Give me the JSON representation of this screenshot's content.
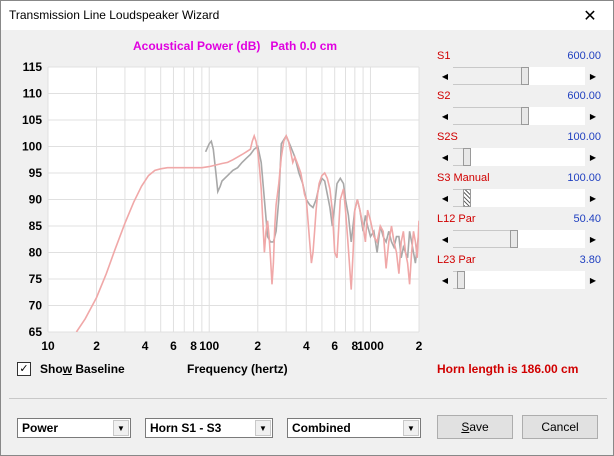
{
  "window": {
    "title": "Transmission Line Loudspeaker Wizard",
    "close_glyph": "✕"
  },
  "chart_header": "Acoustical Power (dB)   Path 0.0 cm",
  "chart_data": {
    "type": "line",
    "title": "Acoustical Power (dB)   Path 0.0 cm",
    "xlabel": "Frequency (hertz)",
    "ylabel": "",
    "x_scale": "log",
    "xlim": [
      10,
      2000
    ],
    "ylim": [
      65,
      115
    ],
    "y_ticks": [
      65,
      70,
      75,
      80,
      85,
      90,
      95,
      100,
      105,
      110,
      115
    ],
    "x_tick_labels": [
      {
        "value": 10,
        "label": "10"
      },
      {
        "value": 20,
        "label": "2"
      },
      {
        "value": 40,
        "label": "4"
      },
      {
        "value": 60,
        "label": "6"
      },
      {
        "value": 80,
        "label": "8"
      },
      {
        "value": 100,
        "label": "100"
      },
      {
        "value": 200,
        "label": "2"
      },
      {
        "value": 400,
        "label": "4"
      },
      {
        "value": 600,
        "label": "6"
      },
      {
        "value": 800,
        "label": "8"
      },
      {
        "value": 1000,
        "label": "1000"
      },
      {
        "value": 2000,
        "label": "2"
      }
    ],
    "grid": true,
    "series": [
      {
        "color": "#a8a8a8",
        "x": [
          95,
          100,
          103,
          106,
          110,
          113,
          117,
          120,
          130,
          140,
          150,
          160,
          170,
          180,
          190,
          200,
          210,
          220,
          230,
          240,
          250,
          260,
          270,
          280,
          300,
          320,
          340,
          360,
          380,
          400,
          420,
          440,
          460,
          480,
          500,
          520,
          540,
          560,
          580,
          600,
          620,
          650,
          680,
          700,
          730,
          760,
          800,
          830,
          860,
          900,
          930,
          960,
          1000,
          1050,
          1100,
          1150,
          1200,
          1250,
          1300,
          1350,
          1400,
          1450,
          1500,
          1550,
          1600,
          1650,
          1700,
          1750,
          1800,
          1850,
          1900,
          2000
        ],
        "y": [
          99,
          100.5,
          101,
          99.5,
          95,
          91.5,
          92.5,
          93.5,
          94.5,
          95.5,
          96,
          97,
          97.8,
          98.5,
          99.5,
          100,
          97,
          90,
          83,
          82,
          82,
          84,
          90,
          100.5,
          102,
          100,
          98,
          95,
          93,
          90,
          89,
          88.5,
          90,
          92.5,
          94,
          93.5,
          91,
          88.5,
          85,
          89,
          93,
          94,
          93,
          90,
          87,
          82,
          88,
          90,
          88,
          84,
          87,
          85,
          83,
          84,
          80,
          85,
          83,
          82,
          84,
          82,
          81,
          83,
          83,
          79,
          81,
          80,
          79,
          84,
          82,
          80,
          78,
          84
        ]
      },
      {
        "color": "#f0a8a8",
        "x": [
          15,
          17,
          20,
          23,
          26,
          30,
          34,
          38,
          42,
          46,
          50,
          55,
          60,
          70,
          80,
          90,
          100,
          110,
          120,
          130,
          140,
          150,
          160,
          170,
          180,
          185,
          190,
          195,
          200,
          205,
          210,
          215,
          220,
          225,
          230,
          235,
          240,
          245,
          250,
          255,
          260,
          270,
          280,
          290,
          300,
          310,
          320,
          330,
          340,
          350,
          360,
          370,
          380,
          390,
          400,
          410,
          420,
          430,
          440,
          450,
          460,
          470,
          480,
          500,
          520,
          540,
          560,
          580,
          600,
          620,
          650,
          680,
          700,
          720,
          740,
          760,
          780,
          800,
          830,
          860,
          900,
          930,
          960,
          1000,
          1050,
          1100,
          1150,
          1200,
          1250,
          1300,
          1350,
          1400,
          1450,
          1500,
          1550,
          1600,
          1650,
          1700,
          1750,
          1800,
          1850,
          1900,
          1950,
          2000
        ],
        "y": [
          65,
          67.5,
          71.5,
          76,
          80.5,
          85.5,
          89.5,
          92.5,
          94.5,
          95.5,
          95.8,
          96,
          96,
          96,
          96,
          96,
          96.2,
          96.5,
          96.8,
          97,
          97.5,
          98,
          98.5,
          99,
          99.5,
          101,
          102,
          101,
          99,
          96,
          92,
          86,
          80,
          84,
          86,
          83,
          79,
          74,
          78,
          85,
          89,
          93,
          98,
          101,
          102,
          101,
          99,
          97,
          98,
          97,
          96,
          95,
          93,
          91,
          90,
          86,
          82,
          78,
          80,
          84,
          88,
          91,
          93,
          94.5,
          95,
          94,
          92,
          88,
          80,
          79,
          90,
          92,
          88,
          83,
          78,
          73,
          80,
          88,
          90,
          88,
          85,
          82,
          88,
          86,
          83,
          82,
          85,
          84,
          77,
          82,
          85,
          82,
          80,
          76,
          82,
          84,
          80,
          78,
          74,
          80,
          84,
          82,
          79,
          86
        ]
      }
    ]
  },
  "sliders": [
    {
      "label": "S1",
      "value": "600.00",
      "level_percent": 55
    },
    {
      "label": "S2",
      "value": "600.00",
      "level_percent": 55
    },
    {
      "label": "S2S",
      "value": "100.00",
      "level_percent": 8
    },
    {
      "label": "S3  Manual",
      "value": "100.00",
      "level_percent": 8
    },
    {
      "label": "L12  Par",
      "value": "50.40",
      "level_percent": 46
    },
    {
      "label": "L23  Par",
      "value": "3.80",
      "level_percent": 3
    }
  ],
  "baseline": {
    "label_before": "Sho",
    "label_mnemonic": "w",
    "label_after": " Baseline",
    "checked_glyph": "✓"
  },
  "xaxis_title": "Frequency (hertz)",
  "horn_length": "Horn length is 186.00 cm",
  "dropdowns": [
    {
      "value": "Power"
    },
    {
      "value": "Horn S1 - S3"
    },
    {
      "value": "Combined"
    }
  ],
  "dropdown_arrow_glyph": "▼",
  "buttons": {
    "save_mnemonic": "S",
    "save_rest": "ave",
    "cancel": "Cancel"
  },
  "arrows": {
    "left": "◀",
    "right": "▶"
  }
}
